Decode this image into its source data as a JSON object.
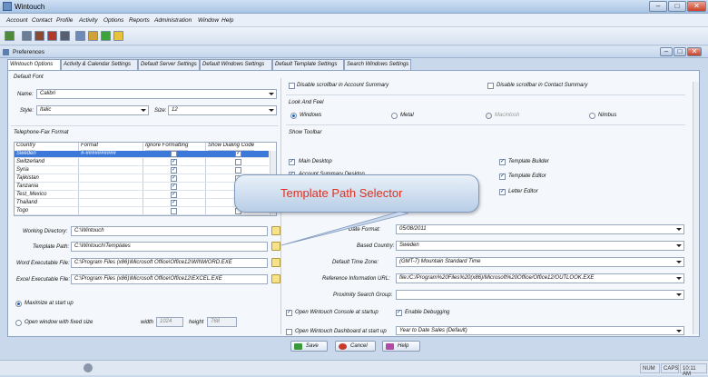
{
  "window": {
    "title": "Wintouch",
    "min": "–",
    "max": "□",
    "close": "✕"
  },
  "menu": [
    "Account",
    "Contact",
    "Profile",
    "Activity",
    "Options",
    "Reports",
    "Administration",
    "Window",
    "Help"
  ],
  "pref": {
    "title": "Preferences"
  },
  "tabs": [
    "Wintouch Options",
    "Activity & Calendar Settings",
    "Default Server Settings",
    "Default Windows Settings",
    "Default Template Settings",
    "Search Windows Settings"
  ],
  "left": {
    "default_font": "Default Font",
    "name_label": "Name:",
    "name_value": "Calibri",
    "style_label": "Style:",
    "style_value": "Italic",
    "size_label": "Size:",
    "size_value": "12",
    "tel_title": "Telephone-Fax Format",
    "grid_headers": [
      "Country",
      "Format",
      "Ignore Formatting",
      "Show Dialing Code"
    ],
    "rows": [
      {
        "country": "Sweden",
        "format": "#-##########",
        "ignore": false,
        "dial": true,
        "sel": true
      },
      {
        "country": "Switzerland",
        "format": "",
        "ignore": true,
        "dial": false
      },
      {
        "country": "Syria",
        "format": "",
        "ignore": true,
        "dial": false
      },
      {
        "country": "Tajikistan",
        "format": "",
        "ignore": true,
        "dial": false
      },
      {
        "country": "Tanzania",
        "format": "",
        "ignore": true,
        "dial": false
      },
      {
        "country": "Test_Mexico",
        "format": "",
        "ignore": true,
        "dial": false
      },
      {
        "country": "Thailand",
        "format": "",
        "ignore": true,
        "dial": false
      },
      {
        "country": "Togo",
        "format": "",
        "ignore": false,
        "dial": false
      }
    ],
    "workdir_label": "Working Directory:",
    "workdir_value": "C:\\Wintouch",
    "tpl_label": "Template Path:",
    "tpl_value": "C:\\Wintouch\\Templates",
    "word_label": "Word Executable File:",
    "word_value": "C:\\Program Files (x86)\\Microsoft Office\\Office12\\WINWORD.EXE",
    "excel_label": "Excel Executable File:",
    "excel_value": "C:\\Program Files (x86)\\Microsoft Office\\Office12\\EXCEL.EXE",
    "maximize": "Maximize at start up",
    "fixed": "Open window with fixed size",
    "width_label": "width",
    "width_value": "1024",
    "height_label": "height",
    "height_value": "768"
  },
  "right": {
    "dis_account": "Disable scrollbar in Account Summary",
    "dis_contact": "Disable scrollbar in Contact Summary",
    "laf": "Look And Feel",
    "laf_opts": [
      "Windows",
      "Metal",
      "Macintosh",
      "Nimbus"
    ],
    "show_toolbar": "Show Toolbar",
    "main_desktop": "Main Desktop",
    "acct_desktop": "Account Summary Desktop",
    "tpl_builder": "Template Builder",
    "tpl_editor": "Template Editor",
    "letter_editor": "Letter Editor",
    "date_label": "Date Format:",
    "date_value": "05/08/2011",
    "country_label": "Based Country:",
    "country_value": "Sweden",
    "tz_label": "Default Time Zone:",
    "tz_value": "(GMT-7) Mountain Standard Time",
    "ref_label": "Reference Information URL:",
    "ref_value": "file:/C:/Program%20Files%20(x86)/Microsoft%20Office/Office12/OUTLOOK.EXE",
    "prox_label": "Proximity Search Group:",
    "prox_value": "",
    "console": "Open Wintouch Console at startup",
    "debug": "Enable Debugging",
    "dashboard": "Open Wintouch Dashboard at start up",
    "dash_value": "Year to Date Sales (Default)"
  },
  "callout": "Template Path Selector",
  "buttons": {
    "save": "Save",
    "cancel": "Cancel",
    "help": "Help"
  },
  "status": {
    "num": "NUM",
    "caps": "CAPS",
    "time": "10:11 AM"
  }
}
